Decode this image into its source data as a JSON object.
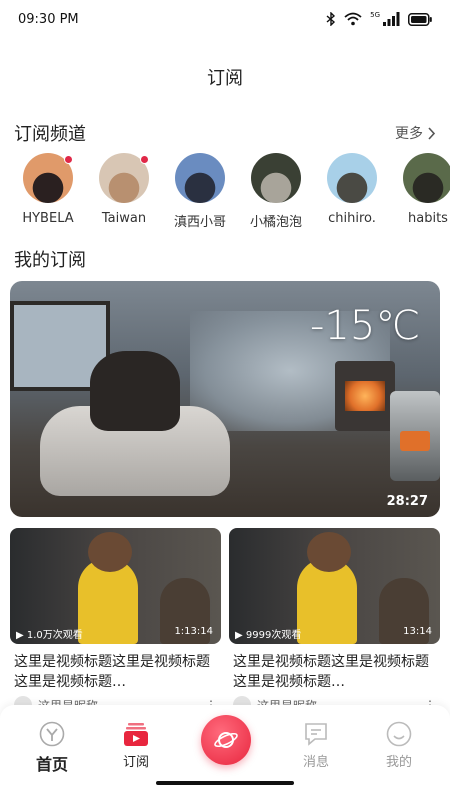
{
  "status": {
    "time": "09:30 PM",
    "network": "5G"
  },
  "page": {
    "title": "订阅"
  },
  "channels_section": {
    "title": "订阅频道",
    "more_label": "更多"
  },
  "channels": [
    {
      "name": "HYBELA",
      "has_update": true,
      "colors": [
        "#e09a6a",
        "#2a2020"
      ]
    },
    {
      "name": "Taiwan",
      "has_update": true,
      "colors": [
        "#d8c6b4",
        "#b89070"
      ]
    },
    {
      "name": "滇西小哥",
      "has_update": false,
      "colors": [
        "#6a8cc0",
        "#2a3040"
      ]
    },
    {
      "name": "小橘泡泡",
      "has_update": false,
      "colors": [
        "#3a4034",
        "#a8a49a"
      ]
    },
    {
      "name": "chihiro.",
      "has_update": false,
      "colors": [
        "#a8d0e8",
        "#4a4a44"
      ]
    },
    {
      "name": "habits",
      "has_update": false,
      "colors": [
        "#5a6a4a",
        "#2a2a24"
      ]
    }
  ],
  "my_subs": {
    "title": "我的订阅"
  },
  "hero_video": {
    "overlay_text": "-15℃",
    "duration": "28:27"
  },
  "videos": [
    {
      "views": "1.0万次观看",
      "duration": "1:13:14",
      "title": "这里是视频标题这里是视频标题这里是视频标题…",
      "author": "这里是昵称"
    },
    {
      "views": "9999次观看",
      "duration": "13:14",
      "title": "这里是视频标题这里是视频标题这里是视频标题…",
      "author": "这里是昵称"
    }
  ],
  "tabbar": {
    "home": "首页",
    "subscribe": "订阅",
    "messages": "消息",
    "me": "我的"
  },
  "colors": {
    "accent": "#e8263e",
    "text": "#222222",
    "muted": "#999999"
  }
}
